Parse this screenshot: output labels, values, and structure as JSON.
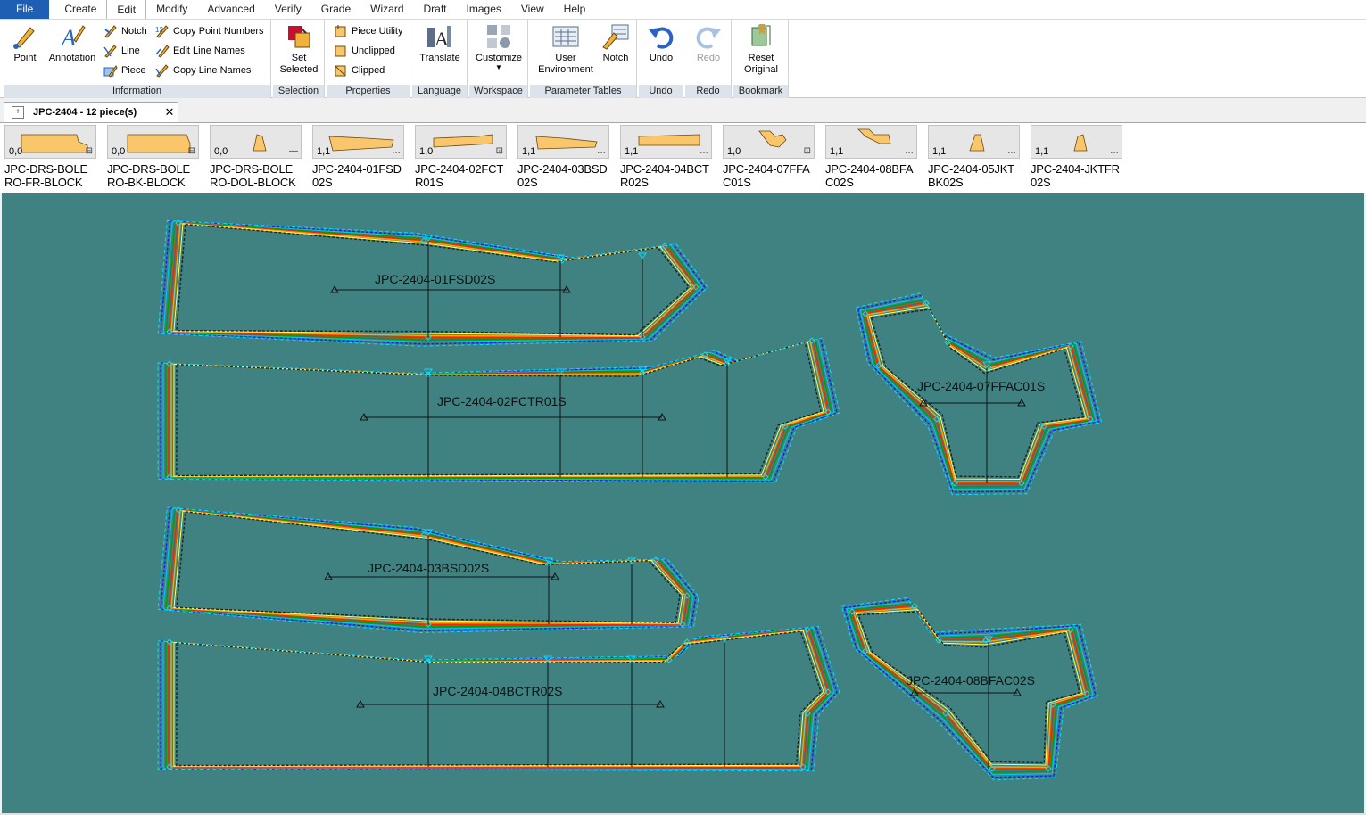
{
  "menu": {
    "tabs": [
      "File",
      "Create",
      "Edit",
      "Modify",
      "Advanced",
      "Verify",
      "Grade",
      "Wizard",
      "Draft",
      "Images",
      "View",
      "Help"
    ],
    "active_tab": "Edit"
  },
  "ribbon": {
    "information": {
      "label": "Information",
      "point": "Point",
      "annotation": "Annotation",
      "notch": "Notch",
      "line": "Line",
      "piece": "Piece",
      "copy_point_numbers": "Copy Point Numbers",
      "edit_line_names": "Edit Line Names",
      "copy_line_names": "Copy Line Names"
    },
    "selection": {
      "label": "Selection",
      "set_selected_1": "Set",
      "set_selected_2": "Selected"
    },
    "properties": {
      "label": "Properties",
      "piece_utility": "Piece Utility",
      "unclipped": "Unclipped",
      "clipped": "Clipped"
    },
    "language": {
      "label": "Language",
      "translate": "Translate"
    },
    "workspace": {
      "label": "Workspace",
      "customize": "Customize"
    },
    "parameter_tables": {
      "label": "Parameter Tables",
      "user_env_1": "User",
      "user_env_2": "Environment",
      "notch": "Notch"
    },
    "undo": {
      "label": "Undo",
      "button": "Undo"
    },
    "redo": {
      "label": "Redo",
      "button": "Redo"
    },
    "bookmark": {
      "label": "Bookmark",
      "reset_1": "Reset",
      "reset_2": "Original"
    }
  },
  "document_tab": {
    "title": "JPC-2404  -  12 piece(s)",
    "close": "✕"
  },
  "thumbnails": [
    {
      "coord": "0,0",
      "badge": "⊟",
      "name1": "JPC-DRS-BOLE",
      "name2": "RO-FR-BLOCK"
    },
    {
      "coord": "0,0",
      "badge": "⊟",
      "name1": "JPC-DRS-BOLE",
      "name2": "RO-BK-BLOCK"
    },
    {
      "coord": "0,0",
      "badge": "—",
      "name1": "JPC-DRS-BOLE",
      "name2": "RO-DOL-BLOCK"
    },
    {
      "coord": "1,1",
      "badge": "…",
      "name1": "JPC-2404-01FSD",
      "name2": "02S"
    },
    {
      "coord": "1,0",
      "badge": "⊡",
      "name1": "JPC-2404-02FCT",
      "name2": "R01S"
    },
    {
      "coord": "1,1",
      "badge": "…",
      "name1": "JPC-2404-03BSD",
      "name2": "02S"
    },
    {
      "coord": "1,1",
      "badge": "…",
      "name1": "JPC-2404-04BCT",
      "name2": "R02S"
    },
    {
      "coord": "1,0",
      "badge": "⊡",
      "name1": "JPC-2404-07FFA",
      "name2": "C01S"
    },
    {
      "coord": "1,1",
      "badge": "…",
      "name1": "JPC-2404-08BFA",
      "name2": "C02S"
    },
    {
      "coord": "1,1",
      "badge": "…",
      "name1": "JPC-2404-05JKT",
      "name2": "BK02S"
    },
    {
      "coord": "1,1",
      "badge": "…",
      "name1": "JPC-2404-JKTFR",
      "name2": "02S"
    }
  ],
  "canvas_labels": {
    "p1": "JPC-2404-01FSD02S",
    "p2": "JPC-2404-02FCTR01S",
    "p3": "JPC-2404-07FFAC01S",
    "p4": "JPC-2404-03BSD02S",
    "p5": "JPC-2404-04BCTR02S",
    "p6": "JPC-2404-08BFAC02S"
  },
  "colors": {
    "canvas_bg": "#408282",
    "grade_lines": [
      "#1a1aff",
      "#00c8ff",
      "#00a000",
      "#ff2000",
      "#ffa500",
      "#ffff60",
      "#202020"
    ],
    "menu_file_bg": "#1f5fb3",
    "piece_fill": "#f9c66b"
  }
}
